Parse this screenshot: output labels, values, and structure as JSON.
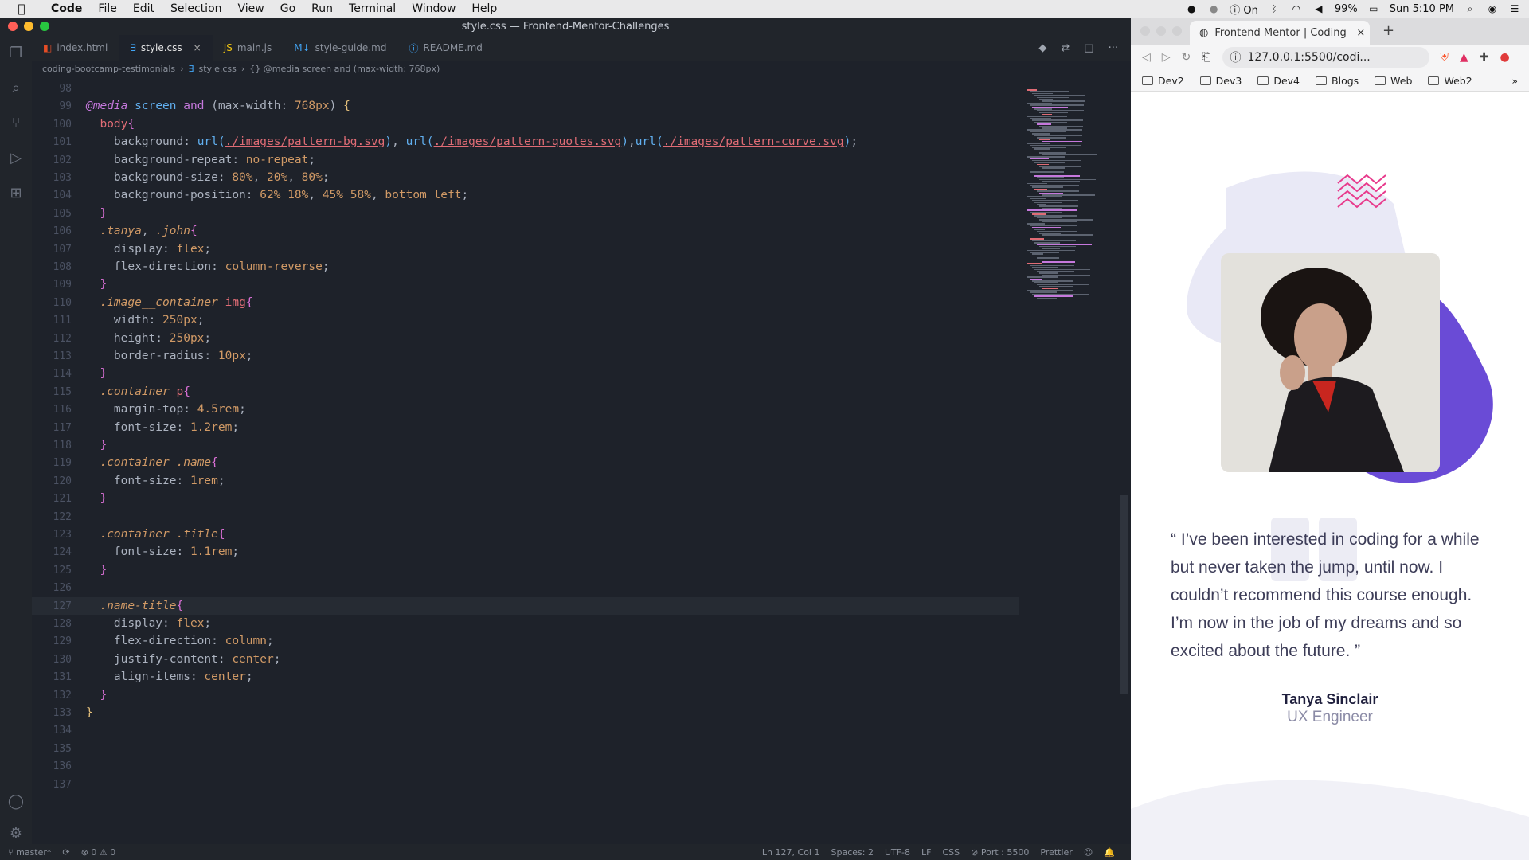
{
  "menubar": {
    "app": "Code",
    "items": [
      "File",
      "Edit",
      "Selection",
      "View",
      "Go",
      "Run",
      "Terminal",
      "Window",
      "Help"
    ],
    "status": {
      "vpn": "On",
      "battery": "99%",
      "clock": "Sun 5:10 PM"
    }
  },
  "window": {
    "title": "style.css — Frontend-Mentor-Challenges"
  },
  "tabs": [
    {
      "label": "index.html",
      "icon": "html-icon"
    },
    {
      "label": "style.css",
      "icon": "css-icon",
      "active": true
    },
    {
      "label": "main.js",
      "icon": "js-icon"
    },
    {
      "label": "style-guide.md",
      "icon": "markdown-icon"
    },
    {
      "label": "README.md",
      "icon": "info-icon"
    }
  ],
  "breadcrumb": {
    "folder": "coding-bootcamp-testimonials",
    "file": "style.css",
    "symbol": "{} @media screen and (max-width: 768px)"
  },
  "editor": {
    "lines": [
      {
        "n": "98",
        "html": ""
      },
      {
        "n": "99",
        "html": "<span class='kw it'>@media</span> <span class='fn'>screen</span> <span class='kw'>and</span> <span class='pl'>(max-width: </span><span class='val'>768px</span><span class='pl'>)</span> <span class='br'>{</span>"
      },
      {
        "n": "100",
        "html": "  <span class='sel'>body</span><span class='brace'>{</span>"
      },
      {
        "n": "101",
        "html": "    <span class='prop'>background: </span><span class='fn'>url(</span><span class='url'>./images/pattern-bg.svg</span><span class='fn'>)</span><span class='pl'>, </span><span class='fn'>url(</span><span class='url'>./images/pattern-quotes.svg</span><span class='fn'>)</span><span class='pl'>,</span><span class='fn'>url(</span><span class='url'>./images/pattern-curve.svg</span><span class='fn'>)</span><span class='pl'>;</span>"
      },
      {
        "n": "102",
        "html": "    <span class='prop'>background-repeat: </span><span class='val'>no-repeat</span><span class='pl'>;</span>"
      },
      {
        "n": "103",
        "html": "    <span class='prop'>background-size: </span><span class='val'>80%</span><span class='pl'>, </span><span class='val'>20%</span><span class='pl'>, </span><span class='val'>80%</span><span class='pl'>;</span>"
      },
      {
        "n": "104",
        "html": "    <span class='prop'>background-position: </span><span class='val'>62% 18%</span><span class='pl'>, </span><span class='val'>45% 58%</span><span class='pl'>, </span><span class='val'>bottom left</span><span class='pl'>;</span>"
      },
      {
        "n": "105",
        "html": "  <span class='brace'>}</span>"
      },
      {
        "n": "106",
        "html": "  <span class='cls'>.tanya</span><span class='pl'>, </span><span class='cls'>.john</span><span class='brace'>{</span>"
      },
      {
        "n": "107",
        "html": "    <span class='prop'>display: </span><span class='val'>flex</span><span class='pl'>;</span>"
      },
      {
        "n": "108",
        "html": "    <span class='prop'>flex-direction: </span><span class='val'>column-reverse</span><span class='pl'>;</span>"
      },
      {
        "n": "109",
        "html": "  <span class='brace'>}</span>"
      },
      {
        "n": "110",
        "html": "  <span class='cls'>.image__container</span> <span class='sel'>img</span><span class='brace'>{</span>"
      },
      {
        "n": "111",
        "html": "    <span class='prop'>width: </span><span class='val'>250px</span><span class='pl'>;</span>"
      },
      {
        "n": "112",
        "html": "    <span class='prop'>height: </span><span class='val'>250px</span><span class='pl'>;</span>"
      },
      {
        "n": "113",
        "html": "    <span class='prop'>border-radius: </span><span class='val'>10px</span><span class='pl'>;</span>"
      },
      {
        "n": "114",
        "html": "  <span class='brace'>}</span>"
      },
      {
        "n": "115",
        "html": "  <span class='cls'>.container</span> <span class='sel'>p</span><span class='brace'>{</span>"
      },
      {
        "n": "116",
        "html": "    <span class='prop'>margin-top: </span><span class='val'>4.5rem</span><span class='pl'>;</span>"
      },
      {
        "n": "117",
        "html": "    <span class='prop'>font-size: </span><span class='val'>1.2rem</span><span class='pl'>;</span>"
      },
      {
        "n": "118",
        "html": "  <span class='brace'>}</span>"
      },
      {
        "n": "119",
        "html": "  <span class='cls'>.container</span> <span class='cls'>.name</span><span class='brace'>{</span>"
      },
      {
        "n": "120",
        "html": "    <span class='prop'>font-size: </span><span class='val'>1rem</span><span class='pl'>;</span>"
      },
      {
        "n": "121",
        "html": "  <span class='brace'>}</span>"
      },
      {
        "n": "122",
        "html": ""
      },
      {
        "n": "123",
        "html": "  <span class='cls'>.container</span> <span class='cls'>.title</span><span class='brace'>{</span>"
      },
      {
        "n": "124",
        "html": "    <span class='prop'>font-size: </span><span class='val'>1.1rem</span><span class='pl'>;</span>"
      },
      {
        "n": "125",
        "html": "  <span class='brace'>}</span>"
      },
      {
        "n": "126",
        "html": ""
      },
      {
        "n": "127",
        "html": "  <span class='cls'>.name-title</span><span class='brace'>{</span>",
        "current": true
      },
      {
        "n": "128",
        "html": "    <span class='prop'>display: </span><span class='val'>flex</span><span class='pl'>;</span>"
      },
      {
        "n": "129",
        "html": "    <span class='prop'>flex-direction: </span><span class='val'>column</span><span class='pl'>;</span>"
      },
      {
        "n": "130",
        "html": "    <span class='prop'>justify-content: </span><span class='val'>center</span><span class='pl'>;</span>"
      },
      {
        "n": "131",
        "html": "    <span class='prop'>align-items: </span><span class='val'>center</span><span class='pl'>;</span>"
      },
      {
        "n": "132",
        "html": "  <span class='brace'>}</span>"
      },
      {
        "n": "133",
        "html": "<span class='br'>}</span>"
      },
      {
        "n": "134",
        "html": ""
      },
      {
        "n": "135",
        "html": ""
      },
      {
        "n": "136",
        "html": ""
      },
      {
        "n": "137",
        "html": ""
      }
    ]
  },
  "statusbar": {
    "branch": "master*",
    "problems": "⊗ 0 ⚠ 0",
    "position": "Ln 127, Col 1",
    "spaces": "Spaces: 2",
    "encoding": "UTF-8",
    "eol": "LF",
    "language": "CSS",
    "port": "⊘ Port : 5500",
    "formatter": "Prettier"
  },
  "browser": {
    "tab_title": "Frontend Mentor | Coding Bootc",
    "url": "127.0.0.1:5500/codi...",
    "bookmarks": [
      "Dev2",
      "Dev3",
      "Dev4",
      "Blogs",
      "Web",
      "Web2"
    ],
    "quote": "“ I’ve been interested in coding for a while but never taken the jump, until now. I couldn’t recommend this course enough. I’m now in the job of my dreams and so excited about the future. ”",
    "name": "Tanya Sinclair",
    "title": "UX Engineer"
  },
  "colors": {
    "accent": "#528bff",
    "purple": "#5c3fcf",
    "pink": "#e83a8c"
  }
}
